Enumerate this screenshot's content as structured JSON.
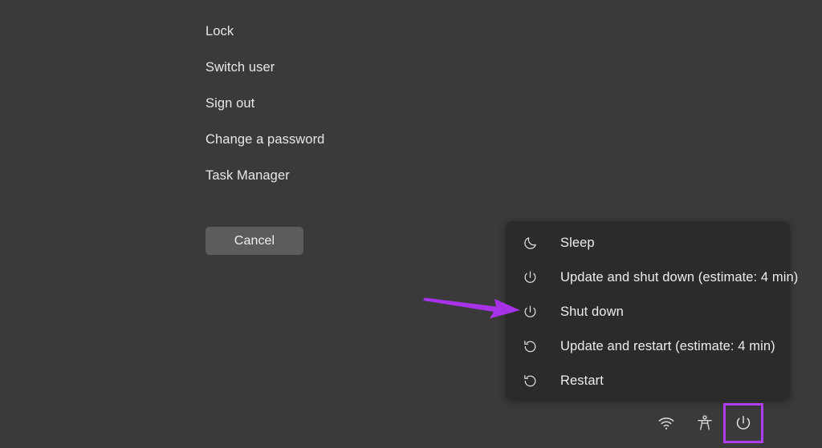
{
  "screen": {
    "background_color": "#3a3a3a",
    "kind": "windows-security-screen"
  },
  "options": {
    "items": [
      {
        "label": "Lock",
        "name": "lock"
      },
      {
        "label": "Switch user",
        "name": "switch-user"
      },
      {
        "label": "Sign out",
        "name": "sign-out"
      },
      {
        "label": "Change a password",
        "name": "change-a-password"
      },
      {
        "label": "Task Manager",
        "name": "task-manager"
      }
    ]
  },
  "cancel": {
    "label": "Cancel",
    "background_color": "#5c5c5c"
  },
  "power_menu": {
    "background_color": "#2b2b2b",
    "items": [
      {
        "label": "Sleep",
        "icon": "moon-icon",
        "name": "sleep"
      },
      {
        "label": "Update and shut down (estimate: 4 min)",
        "icon": "power-icon",
        "name": "update-and-shut-down"
      },
      {
        "label": "Shut down",
        "icon": "power-icon",
        "name": "shut-down"
      },
      {
        "label": "Update and restart (estimate: 4 min)",
        "icon": "restart-icon",
        "name": "update-and-restart"
      },
      {
        "label": "Restart",
        "icon": "restart-icon",
        "name": "restart"
      }
    ]
  },
  "annotation": {
    "arrow_color": "#a633e8",
    "points_to": "Shut down",
    "highlight_color": "#b13df0",
    "highlight_target": "power-tray-button"
  },
  "system_tray": {
    "items": [
      {
        "icon": "wifi-icon",
        "name": "network",
        "label": "Network"
      },
      {
        "icon": "accessibility-icon",
        "name": "ease-of-access",
        "label": "Ease of Access"
      },
      {
        "icon": "power-icon",
        "name": "power",
        "label": "Power"
      }
    ]
  }
}
